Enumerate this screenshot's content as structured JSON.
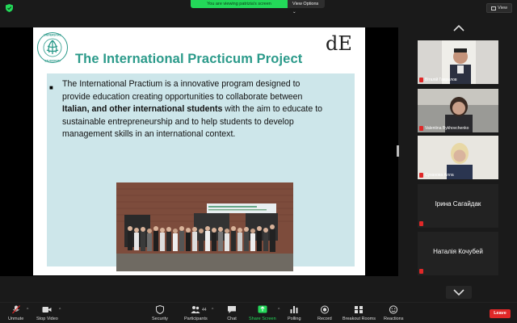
{
  "top_bar": {
    "share_banner": "You are viewing patrizia's screen",
    "view_options": "View Options",
    "view_button": "View"
  },
  "slide": {
    "title": "The International Practicum Project",
    "logo_text": "UNIVERSITAS STUDIORUM",
    "de_logo": "dE",
    "paragraph": {
      "line1": "The International Practium is a innovative program designed to",
      "line2": "provide education creating opportunities to collaborate between",
      "line3_bold": "Italian, and other international students",
      "line3_rest": " with the aim to educate to",
      "line4": "sustainable entrepreneurship and to help students to develop",
      "line5": "management skills in an international context."
    }
  },
  "gallery": {
    "participants": [
      {
        "name": "Віталій Гаврилов",
        "type": "video"
      },
      {
        "name": "Valentina Bykhovchenko",
        "type": "video"
      },
      {
        "name": "Суханова Алла",
        "type": "video"
      },
      {
        "name": "Ірина Сагайдак",
        "type": "name"
      },
      {
        "name": "Наталія Кочубей",
        "type": "name"
      }
    ]
  },
  "toolbar": {
    "unmute": "Unmute",
    "stop_video": "Stop Video",
    "security": "Security",
    "participants": "Participants",
    "participants_count": "44",
    "chat": "Chat",
    "share_screen": "Share Screen",
    "polling": "Polling",
    "record": "Record",
    "breakout_rooms": "Breakout Rooms",
    "reactions": "Reactions",
    "leave": "Leave"
  },
  "colors": {
    "accent_green": "#23d959",
    "title_teal": "#2b9a8a",
    "content_bg": "#cde6ea",
    "leave_red": "#e02828"
  }
}
